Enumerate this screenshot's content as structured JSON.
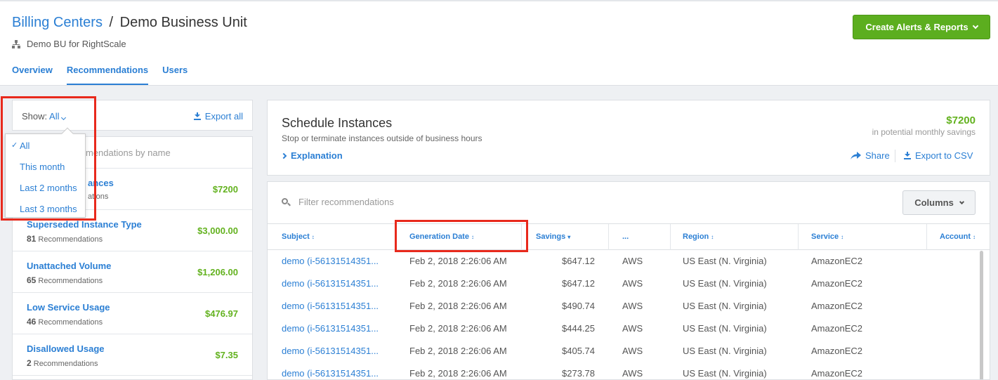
{
  "header": {
    "breadcrumb_link": "Billing Centers",
    "breadcrumb_sep": "/",
    "breadcrumb_current": "Demo Business Unit",
    "subtitle": "Demo BU for RightScale",
    "tabs": [
      {
        "label": "Overview",
        "active": false
      },
      {
        "label": "Recommendations",
        "active": true
      },
      {
        "label": "Users",
        "active": false
      }
    ],
    "cta_label": "Create Alerts & Reports",
    "cta_color": "#5cae1f"
  },
  "left_panel": {
    "show_label": "Show:",
    "show_value": "All",
    "export_label": "Export all",
    "search_placeholder": "Filter recommendations by name",
    "search_visible": "mendations by name",
    "dropdown": {
      "options": [
        "All",
        "This month",
        "Last 2 months",
        "Last 3 months"
      ],
      "selected": "All"
    },
    "recommendations": [
      {
        "title": "Schedule Instances",
        "title_visible": "ances",
        "count": "",
        "count_visible": "ations",
        "value": "$7200"
      },
      {
        "title": "Superseded Instance Type",
        "count": "81",
        "suffix": "Recommendations",
        "value": "$3,000.00"
      },
      {
        "title": "Unattached Volume",
        "count": "65",
        "suffix": "Recommendations",
        "value": "$1,206.00"
      },
      {
        "title": "Low Service Usage",
        "count": "46",
        "suffix": "Recommendations",
        "value": "$476.97"
      },
      {
        "title": "Disallowed Usage",
        "count": "2",
        "suffix": "Recommendations",
        "value": "$7.35"
      }
    ]
  },
  "detail": {
    "title": "Schedule Instances",
    "subtitle": "Stop or terminate instances outside of business hours",
    "explanation_label": "Explanation",
    "savings_value": "$7200",
    "savings_caption": "in potential monthly savings",
    "share_label": "Share",
    "export_csv_label": "Export to CSV",
    "filter_placeholder": "Filter recommendations",
    "columns_label": "Columns"
  },
  "table": {
    "headers": [
      {
        "label": "Subject",
        "sort": "↕"
      },
      {
        "label": "Generation Date",
        "sort": "↕"
      },
      {
        "label": "Savings",
        "sort": "▾"
      },
      {
        "label": "...",
        "sort": ""
      },
      {
        "label": "Region",
        "sort": "↕"
      },
      {
        "label": "Service",
        "sort": "↕"
      },
      {
        "label": "Account",
        "sort": "↕"
      }
    ],
    "rows": [
      {
        "subject": "demo (i-56131514351...",
        "date": "Feb 2, 2018 2:26:06 AM",
        "savings": "$647.12",
        "provider": "AWS",
        "region": "US East (N. Virginia)",
        "service": "AmazonEC2"
      },
      {
        "subject": "demo (i-56131514351...",
        "date": "Feb 2, 2018 2:26:06 AM",
        "savings": "$647.12",
        "provider": "AWS",
        "region": "US East (N. Virginia)",
        "service": "AmazonEC2"
      },
      {
        "subject": "demo (i-56131514351...",
        "date": "Feb 2, 2018 2:26:06 AM",
        "savings": "$490.74",
        "provider": "AWS",
        "region": "US East (N. Virginia)",
        "service": "AmazonEC2"
      },
      {
        "subject": "demo (i-56131514351...",
        "date": "Feb 2, 2018 2:26:06 AM",
        "savings": "$444.25",
        "provider": "AWS",
        "region": "US East (N. Virginia)",
        "service": "AmazonEC2"
      },
      {
        "subject": "demo (i-56131514351...",
        "date": "Feb 2, 2018 2:26:06 AM",
        "savings": "$405.74",
        "provider": "AWS",
        "region": "US East (N. Virginia)",
        "service": "AmazonEC2"
      },
      {
        "subject": "demo (i-56131514351...",
        "date": "Feb 2, 2018 2:26:06 AM",
        "savings": "$273.78",
        "provider": "AWS",
        "region": "US East (N. Virginia)",
        "service": "AmazonEC2"
      }
    ]
  },
  "colors": {
    "link": "#2b7fd4",
    "savings_green": "#63b21f",
    "highlight_red": "#e8291c"
  }
}
